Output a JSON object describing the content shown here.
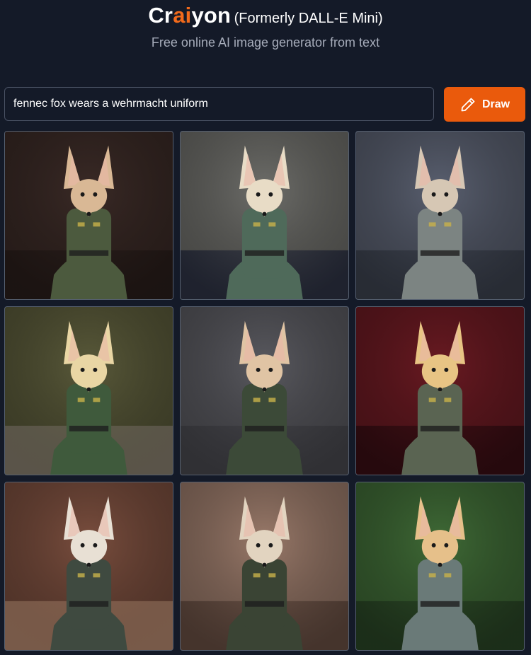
{
  "header": {
    "brand_pre": "Cr",
    "brand_accent": "ai",
    "brand_post": "yon",
    "formerly": "(Formerly DALL-E Mini)",
    "subtitle": "Free online AI image generator from text"
  },
  "prompt": {
    "value": "fennec fox wears a wehrmacht uniform"
  },
  "draw_button": {
    "label": "Draw",
    "icon": "pencil-icon"
  },
  "colors": {
    "background": "#141a28",
    "accent": "#ea5a0c",
    "brand_accent": "#f26a1b"
  },
  "results": [
    {
      "id": 1,
      "bg": "#3a2a26",
      "floor": "#2a1e1b",
      "uniform": "#4c5a3e",
      "fur": "#d9b895"
    },
    {
      "id": 2,
      "bg": "#6e6e6a",
      "floor": "#2f3446",
      "uniform": "#4f6a5a",
      "fur": "#e8dcc6"
    },
    {
      "id": 3,
      "bg": "#5a6070",
      "floor": "#3d4350",
      "uniform": "#7c8482",
      "fur": "#d6c7b4"
    },
    {
      "id": 4,
      "bg": "#5a5a3a",
      "floor": "#8a8270",
      "uniform": "#3f5a3c",
      "fur": "#e9d6a4"
    },
    {
      "id": 5,
      "bg": "#5a5a60",
      "floor": "#4a4a50",
      "uniform": "#3c4a38",
      "fur": "#e0c4a4"
    },
    {
      "id": 6,
      "bg": "#6a1a22",
      "floor": "#3a0e14",
      "uniform": "#5a6452",
      "fur": "#e8c484"
    },
    {
      "id": 7,
      "bg": "#7a4e3e",
      "floor": "#b88a70",
      "uniform": "#3f4a40",
      "fur": "#e8e0d4"
    },
    {
      "id": 8,
      "bg": "#9a7a6a",
      "floor": "#6a5044",
      "uniform": "#3a4434",
      "fur": "#e2d4c0"
    },
    {
      "id": 9,
      "bg": "#3f6a36",
      "floor": "#2a4626",
      "uniform": "#6a7a78",
      "fur": "#e6c08a"
    }
  ]
}
